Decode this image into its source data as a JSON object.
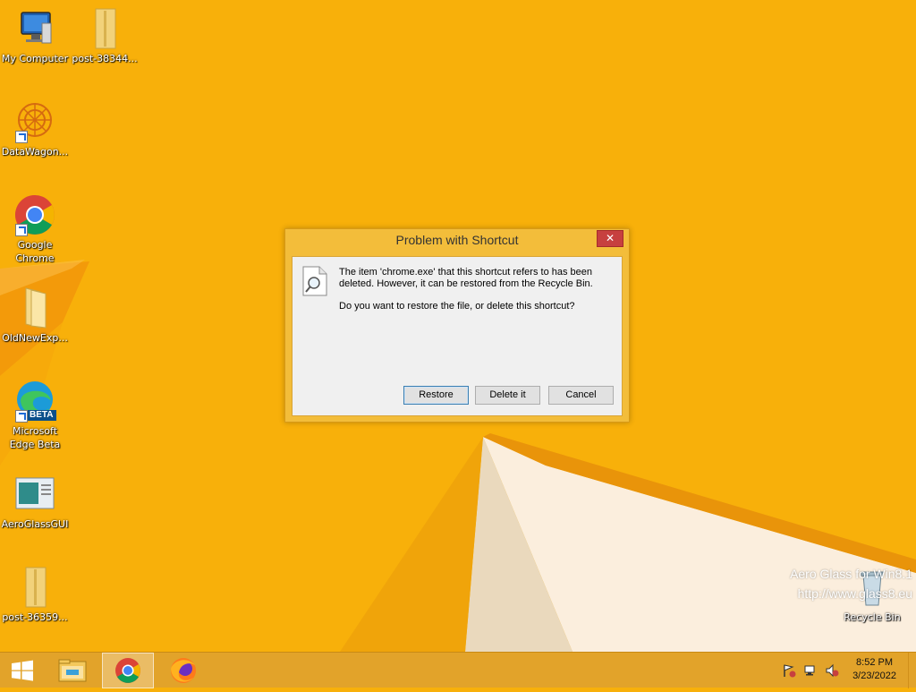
{
  "desktop": {
    "icons": [
      {
        "name": "my-computer",
        "label": "My Computer"
      },
      {
        "name": "post-38344",
        "label": "post-38344..."
      },
      {
        "name": "datawagon",
        "label": "DataWagon..."
      },
      {
        "name": "google-chrome",
        "label": "Google\nChrome"
      },
      {
        "name": "oldnewexp",
        "label": "OldNewExp..."
      },
      {
        "name": "microsoft-edge-beta",
        "label": "Microsoft\nEdge Beta",
        "badge": "BETA"
      },
      {
        "name": "aeroglassgui",
        "label": "AeroGlassGUI"
      },
      {
        "name": "post-36359",
        "label": "post-36359..."
      },
      {
        "name": "recycle-bin",
        "label": "Recycle Bin"
      }
    ]
  },
  "watermark": {
    "line1": "Aero Glass for Win8.1",
    "line2": "http://www.glass8.eu"
  },
  "dialog": {
    "title": "Problem with Shortcut",
    "close_glyph": "✕",
    "message1": "The item 'chrome.exe' that this shortcut refers to has been deleted. However, it can be restored from the Recycle Bin.",
    "message2": "Do you want to restore the file, or delete this shortcut?",
    "buttons": {
      "restore": "Restore",
      "delete": "Delete it",
      "cancel": "Cancel"
    }
  },
  "taskbar": {
    "items": [
      "start",
      "file-explorer",
      "google-chrome",
      "firefox"
    ],
    "active": "google-chrome",
    "tray_icons": [
      "action-center-flag-icon",
      "network-icon",
      "volume-muted-icon"
    ]
  },
  "clock": {
    "time": "8:52 PM",
    "date": "3/23/2022"
  },
  "colors": {
    "wallpaper": "#f8b00a",
    "taskbar": "#e2a32a",
    "dialog_frame": "#f3bd3a",
    "close_button": "#c7403f"
  }
}
